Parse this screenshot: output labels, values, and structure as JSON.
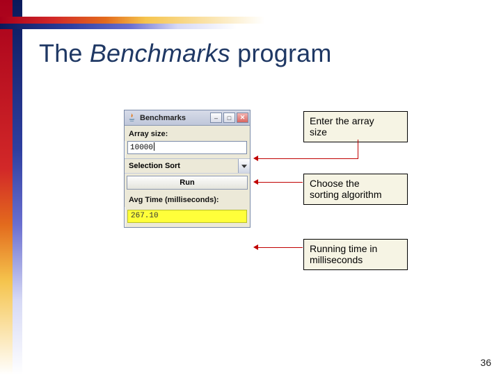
{
  "slide": {
    "title_prefix": "The ",
    "title_emph": "Benchmarks",
    "title_suffix": " program",
    "page_number": "36"
  },
  "app": {
    "window_title": "Benchmarks",
    "labels": {
      "array_size": "Array size:",
      "avg_time": "Avg Time (milliseconds):"
    },
    "fields": {
      "array_size_value": "10000",
      "algorithm_selected": "Selection Sort",
      "run_button": "Run",
      "result_value": "267.10"
    },
    "icons": {
      "java": "java-icon",
      "minimize": "minimize-icon",
      "maximize": "maximize-icon",
      "close": "close-icon",
      "dropdown": "chevron-down-icon"
    }
  },
  "callouts": {
    "c1_l1": "Enter the array",
    "c1_l2": "size",
    "c2_l1": "Choose the",
    "c2_l2": "sorting algorithm",
    "c3_l1": "Running time in",
    "c3_l2": "milliseconds"
  }
}
